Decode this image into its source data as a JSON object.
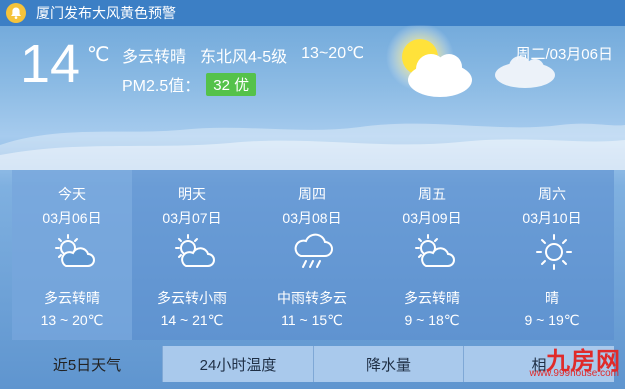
{
  "alert": {
    "text": "厦门发布大风黄色预警",
    "icon": "bell-icon"
  },
  "current": {
    "temp": "14",
    "unit": "℃",
    "condition": "多云转晴",
    "wind": "东北风4-5级",
    "range": "13~20℃",
    "pm_label": "PM2.5值：",
    "pm_value": "32 优",
    "date": "周二/03月06日",
    "icon": "sun-cloud-icon"
  },
  "forecast": [
    {
      "day": "今天",
      "date": "03月06日",
      "condition": "多云转晴",
      "range": "13 ~ 20℃",
      "icon": "partly-cloudy-icon"
    },
    {
      "day": "明天",
      "date": "03月07日",
      "condition": "多云转小雨",
      "range": "14 ~ 21℃",
      "icon": "partly-cloudy-icon"
    },
    {
      "day": "周四",
      "date": "03月08日",
      "condition": "中雨转多云",
      "range": "11 ~ 15℃",
      "icon": "rain-icon"
    },
    {
      "day": "周五",
      "date": "03月09日",
      "condition": "多云转晴",
      "range": "9 ~ 18℃",
      "icon": "partly-cloudy-icon"
    },
    {
      "day": "周六",
      "date": "03月10日",
      "condition": "晴",
      "range": "9 ~ 19℃",
      "icon": "sun-icon"
    }
  ],
  "tabs": [
    {
      "label": "近5日天气",
      "active": true
    },
    {
      "label": "24小时温度",
      "active": false
    },
    {
      "label": "降水量",
      "active": false
    },
    {
      "label": "相",
      "active": false
    }
  ],
  "watermark": {
    "main": "九房网",
    "sub": "www.999house.com"
  },
  "colors": {
    "alert_bar": "#3c7fc5",
    "bell": "#f5c33b",
    "aqi_good": "#55c24a",
    "watermark": "#e02a2a"
  }
}
